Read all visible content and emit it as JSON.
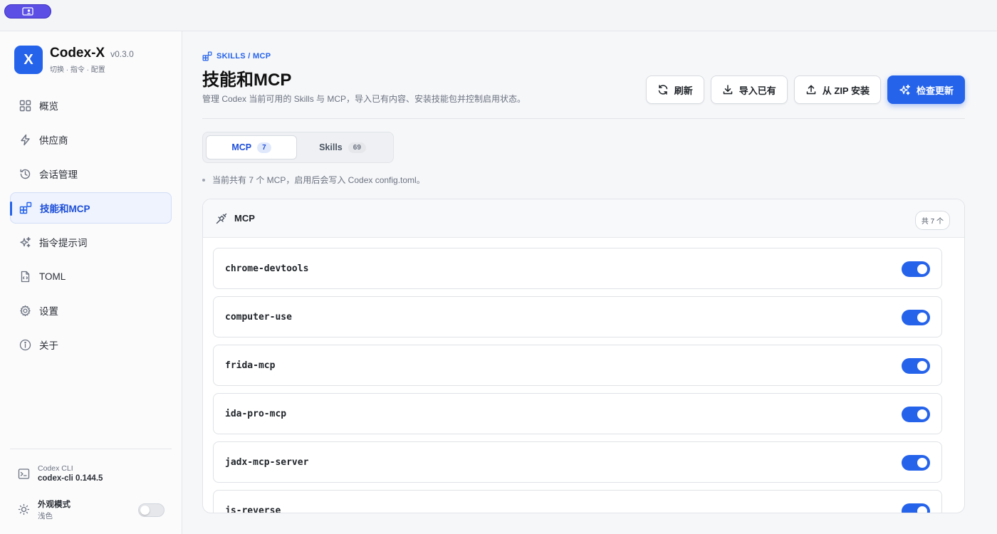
{
  "brand": {
    "logo_letter": "X",
    "name": "Codex-X",
    "version": "v0.3.0",
    "subtitle": "切换 · 指令 · 配置"
  },
  "sidebar": {
    "items": [
      {
        "label": "概览",
        "icon": "grid-icon"
      },
      {
        "label": "供应商",
        "icon": "bolt-icon"
      },
      {
        "label": "会话管理",
        "icon": "history-icon"
      },
      {
        "label": "技能和MCP",
        "icon": "blocks-icon",
        "active": true
      },
      {
        "label": "指令提示词",
        "icon": "sparkles-icon"
      },
      {
        "label": "TOML",
        "icon": "file-code-icon"
      },
      {
        "label": "设置",
        "icon": "gear-icon"
      },
      {
        "label": "关于",
        "icon": "info-icon"
      }
    ],
    "cli": {
      "label": "Codex CLI",
      "value": "codex-cli 0.144.5"
    },
    "theme": {
      "label": "外观模式",
      "value": "浅色"
    }
  },
  "header": {
    "breadcrumb": "SKILLS / MCP",
    "title": "技能和MCP",
    "description": "管理 Codex 当前可用的 Skills 与 MCP，导入已有内容、安装技能包并控制启用状态。"
  },
  "actions": {
    "refresh": "刷新",
    "import": "导入已有",
    "zip": "从 ZIP 安装",
    "check": "检查更新"
  },
  "tabs": [
    {
      "label": "MCP",
      "count": "7",
      "active": true
    },
    {
      "label": "Skills",
      "count": "69"
    }
  ],
  "note": "当前共有 7 个 MCP，启用后会写入 Codex config.toml。",
  "panel": {
    "title": "MCP",
    "count": "共 7 个",
    "items": [
      {
        "name": "chrome-devtools",
        "enabled": true
      },
      {
        "name": "computer-use",
        "enabled": true
      },
      {
        "name": "frida-mcp",
        "enabled": true
      },
      {
        "name": "ida-pro-mcp",
        "enabled": true
      },
      {
        "name": "jadx-mcp-server",
        "enabled": true
      },
      {
        "name": "js-reverse",
        "enabled": true
      }
    ]
  },
  "colors": {
    "accent": "#2563eb",
    "topbar_button": "#5b4fe6"
  }
}
